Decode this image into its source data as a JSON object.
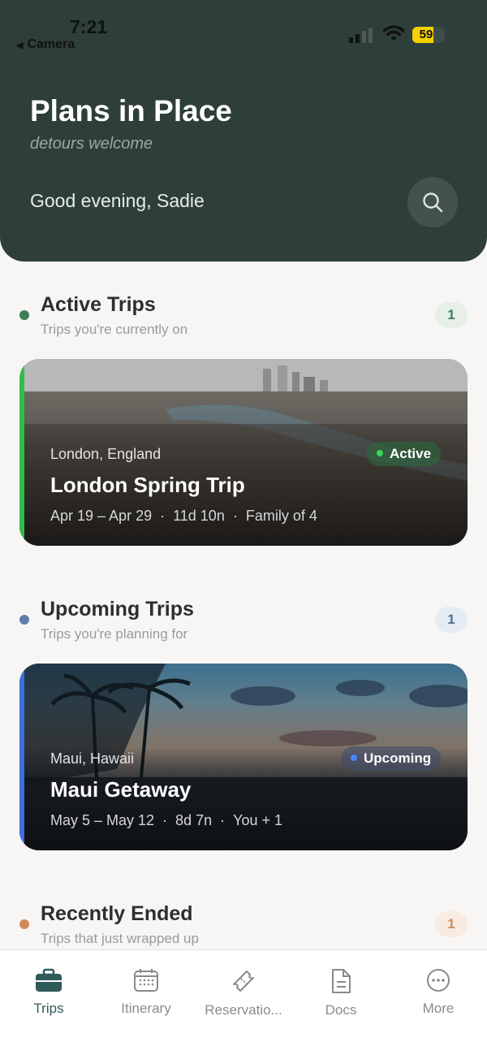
{
  "status_bar": {
    "time": "7:21",
    "back_app": "Camera",
    "battery": "59"
  },
  "header": {
    "title": "Plans in Place",
    "subtitle": "detours welcome",
    "greeting": "Good evening, Sadie",
    "search_icon": "search-icon"
  },
  "sections": {
    "active": {
      "title": "Active Trips",
      "subtitle": "Trips you're currently on",
      "count": "1",
      "color": "#3e7d5a"
    },
    "upcoming": {
      "title": "Upcoming Trips",
      "subtitle": "Trips you're planning for",
      "count": "1",
      "color": "#5b7fa8"
    },
    "ended": {
      "title": "Recently Ended",
      "subtitle": "Trips that just wrapped up",
      "count": "1",
      "color": "#d2895a"
    }
  },
  "trips": {
    "london": {
      "location": "London, England",
      "name": "London Spring Trip",
      "dates": "Apr 19 – Apr 29",
      "duration": "11d 10n",
      "party": "Family of 4",
      "status": "Active",
      "accent": "#2fbf4a"
    },
    "maui": {
      "location": "Maui, Hawaii",
      "name": "Maui Getaway",
      "dates": "May 5 – May 12",
      "duration": "8d 7n",
      "party": "You + 1",
      "status": "Upcoming",
      "accent": "#3d6fe0"
    }
  },
  "tabbar": {
    "tabs": [
      {
        "label": "Trips",
        "icon": "briefcase-icon",
        "active": true
      },
      {
        "label": "Itinerary",
        "icon": "calendar-icon",
        "active": false
      },
      {
        "label": "Reservatio...",
        "icon": "ticket-icon",
        "active": false
      },
      {
        "label": "Docs",
        "icon": "document-icon",
        "active": false
      },
      {
        "label": "More",
        "icon": "more-icon",
        "active": false
      }
    ]
  },
  "colors": {
    "header_bg": "#2d3e3b",
    "page_bg": "#f8f6f4",
    "active_tab": "#2f5a5a"
  }
}
